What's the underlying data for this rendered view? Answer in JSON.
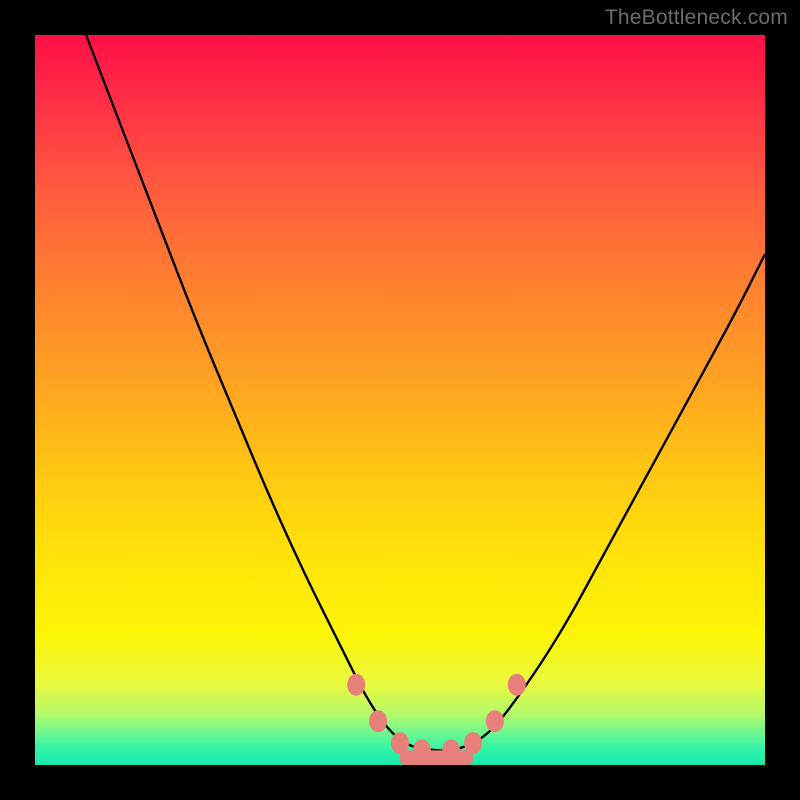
{
  "watermark": "TheBottleneck.com",
  "chart_data": {
    "type": "line",
    "title": "",
    "xlabel": "",
    "ylabel": "",
    "xlim": [
      0,
      100
    ],
    "ylim": [
      0,
      100
    ],
    "grid": false,
    "legend": false,
    "background_gradient": {
      "direction": "vertical",
      "stops": [
        {
          "pos": 0.0,
          "color": "#ff0f46"
        },
        {
          "pos": 0.5,
          "color": "#ffb418"
        },
        {
          "pos": 0.82,
          "color": "#fef506"
        },
        {
          "pos": 1.0,
          "color": "#19e9b0"
        }
      ]
    },
    "series": [
      {
        "name": "bottleneck-curve",
        "color": "#000000",
        "x": [
          7,
          12,
          17,
          22,
          27,
          32,
          37,
          42,
          46,
          50,
          54,
          58,
          62,
          66,
          72,
          78,
          84,
          90,
          96,
          100
        ],
        "y": [
          100,
          87,
          74,
          61,
          49,
          37,
          26,
          16,
          8,
          3,
          2,
          2,
          4,
          9,
          18,
          29,
          40,
          51,
          62,
          70
        ]
      }
    ],
    "markers": [
      {
        "name": "pink-dot",
        "x": 44,
        "y": 11,
        "color": "#e77f7a"
      },
      {
        "name": "pink-dot",
        "x": 47,
        "y": 6,
        "color": "#e77f7a"
      },
      {
        "name": "pink-dot",
        "x": 50,
        "y": 3,
        "color": "#e77f7a"
      },
      {
        "name": "pink-dot",
        "x": 53,
        "y": 2,
        "color": "#e77f7a"
      },
      {
        "name": "pink-dot",
        "x": 57,
        "y": 2,
        "color": "#e77f7a"
      },
      {
        "name": "pink-dot",
        "x": 60,
        "y": 3,
        "color": "#e77f7a"
      },
      {
        "name": "pink-dot",
        "x": 63,
        "y": 6,
        "color": "#e77f7a"
      },
      {
        "name": "pink-dot",
        "x": 66,
        "y": 11,
        "color": "#e77f7a"
      }
    ],
    "bottom_band": {
      "from_y": 0,
      "to_y": 2,
      "color": "#e77f7a",
      "x_from": 50,
      "x_to": 60
    }
  }
}
